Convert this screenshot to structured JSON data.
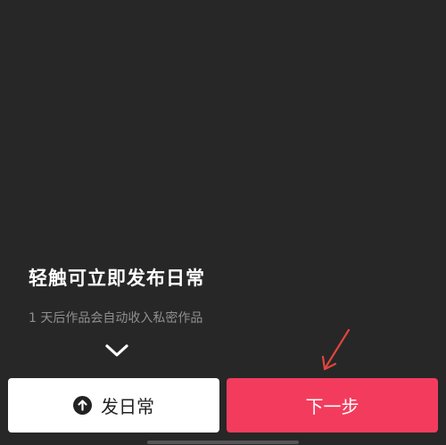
{
  "headline": "轻触可立即发布日常",
  "subtext": "1 天后作品会自动收入私密作品",
  "buttons": {
    "post_daily_label": "发日常",
    "next_step_label": "下一步"
  },
  "icons": {
    "expand": "chevron-down-icon",
    "post": "upload-circle-icon",
    "annotation": "arrow-pointer"
  },
  "colors": {
    "background": "#272727",
    "accent": "#f33c5d",
    "annotation": "#e0453e"
  }
}
